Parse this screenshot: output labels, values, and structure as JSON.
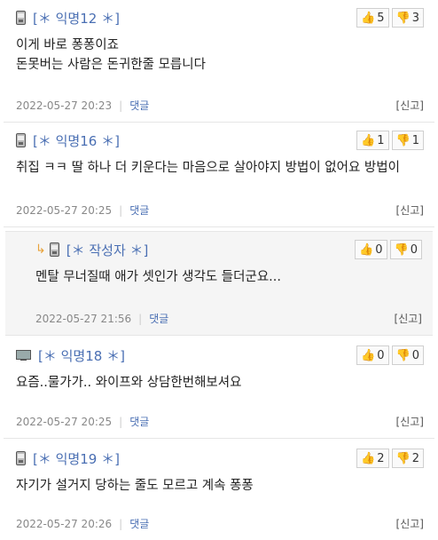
{
  "comments": [
    {
      "author": "[＊ 익명12 ＊]",
      "device_icon": "mobile-phone-icon",
      "lines": [
        "이게 바로 퐁퐁이죠",
        "돈못버는 사람은 돈귀한줄 모릅니다"
      ],
      "likes": "5",
      "dislikes": "3",
      "date": "2022-05-27 20:23",
      "reply_label": "댓글",
      "report_label": "[신고]"
    },
    {
      "author": "[＊ 익명16 ＊]",
      "device_icon": "mobile-phone-icon",
      "lines": [
        "취집 ㅋㅋ 딸 하나 더 키운다는 마음으로 살아야지 방법이 없어요 방법이"
      ],
      "likes": "1",
      "dislikes": "1",
      "date": "2022-05-27 20:25",
      "reply_label": "댓글",
      "report_label": "[신고]"
    },
    {
      "author": "[＊ 작성자 ＊]",
      "device_icon": "mobile-phone-icon",
      "lines": [
        "멘탈 무너질때 애가 셋인가 생각도 들더군요..."
      ],
      "likes": "0",
      "dislikes": "0",
      "date": "2022-05-27 21:56",
      "reply_label": "댓글",
      "report_label": "[신고]"
    },
    {
      "author": "[＊ 익명18 ＊]",
      "device_icon": "desktop-pc-icon",
      "lines": [
        "요즘..물가가.. 와이프와 상담한번해보셔요"
      ],
      "likes": "0",
      "dislikes": "0",
      "date": "2022-05-27 20:25",
      "reply_label": "댓글",
      "report_label": "[신고]"
    },
    {
      "author": "[＊ 익명19 ＊]",
      "device_icon": "mobile-phone-icon",
      "lines": [
        "자기가 설거지 당하는 줄도 모르고 계속 퐁퐁"
      ],
      "likes": "2",
      "dislikes": "2",
      "date": "2022-05-27 20:26",
      "reply_label": "댓글",
      "report_label": "[신고]"
    }
  ],
  "colors": {
    "author": "#4a6fb3",
    "reply_bg": "#f5f5f5",
    "reply_arrow": "#e8a23a"
  }
}
